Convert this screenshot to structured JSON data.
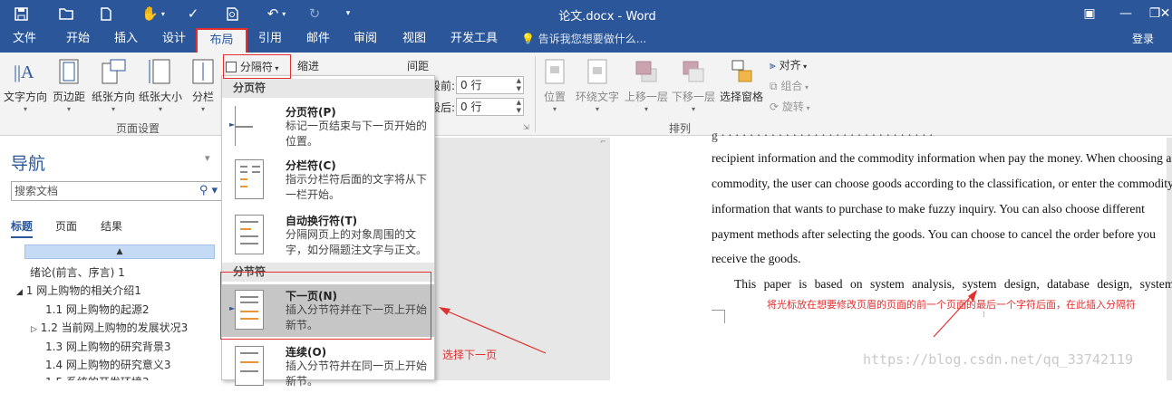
{
  "titlebar": {
    "title": "论文.docx - Word",
    "qat": {
      "save": "save-icon",
      "open": "open-folder-icon",
      "new": "new-document-icon",
      "touch": "touch-mode-icon",
      "spelling": "spelling-icon",
      "print_preview": "print-preview-icon",
      "undo": "undo-icon",
      "redo": "redo-icon",
      "customize": "customize-qat-icon"
    },
    "window_controls": [
      "ribbon-display-icon",
      "minimize-icon",
      "restore-icon",
      "close-icon"
    ]
  },
  "tabs": {
    "file": "文件",
    "home": "开始",
    "insert": "插入",
    "design": "设计",
    "layout": "布局",
    "references": "引用",
    "mailings": "邮件",
    "review": "审阅",
    "view": "视图",
    "developer": "开发工具"
  },
  "tell_me": "告诉我您想要做什么...",
  "signin": "登录",
  "ribbon": {
    "page_setup": {
      "text_direction": "文字方向",
      "margins": "页边距",
      "orientation": "纸张方向",
      "size": "纸张大小",
      "columns": "分栏",
      "breaks": "分隔符",
      "indent": "缩进",
      "spacing": "间距",
      "group_label": "页面设置",
      "spacing_before_label": "段前:",
      "spacing_before": "0 行",
      "spacing_after_label": "段后:",
      "spacing_after": "0 行"
    },
    "arrange": {
      "position": "位置",
      "wrap_text": "环绕文字",
      "bring_forward": "上移一层",
      "send_backward": "下移一层",
      "selection_pane": "选择窗格",
      "align": "对齐",
      "group": "组合",
      "rotate": "旋转",
      "group_label": "排列"
    }
  },
  "breaks_menu": {
    "page_breaks_header": "分页符",
    "section_breaks_header": "分节符",
    "items": [
      {
        "name": "分页符(P)",
        "desc": "标记一页结束与下一页开始的位置。"
      },
      {
        "name": "分栏符(C)",
        "desc": "指示分栏符后面的文字将从下一栏开始。"
      },
      {
        "name": "自动换行符(T)",
        "desc": "分隔网页上的对象周围的文字，如分隔题注文字与正文。"
      },
      {
        "name": "下一页(N)",
        "desc": "插入分节符并在下一页上开始新节。"
      },
      {
        "name": "连续(O)",
        "desc": "插入分节符并在同一页上开始新节。"
      }
    ]
  },
  "navigation": {
    "title": "导航",
    "search_placeholder": "搜索文档",
    "tabs": [
      "标题",
      "页面",
      "结果"
    ],
    "headings": [
      "绪论(前言、序言) 1",
      "1 网上购物的相关介绍1",
      "1.1 网上购物的起源2",
      "1.2 当前网上购物的发展状况3",
      "1.3 网上购物的研究背景3",
      "1.4 网上购物的研究意义3",
      "1.5 系统的开发环境3"
    ]
  },
  "document": {
    "lines": [
      "recipient information and the commodity information when pay the money. When choosing a",
      "commodity, the user can choose goods according to the classification, or enter the commodity",
      "information that wants to purchase to make fuzzy inquiry. You can also choose different",
      "payment methods after selecting the goods. You can choose to cancel the order before you",
      "receive the goods.",
      "This paper is based on system analysis, system design, database design, system"
    ]
  },
  "annotations": {
    "select_next_page": "选择下一页",
    "cursor_note": "将光标放在想要修改页眉的页面的前一个页面的最后一个字符后面，在此插入分隔符"
  },
  "watermark": "https://blog.csdn.net/qq_33742119",
  "colors": {
    "accent": "#2b579a",
    "highlight": "#e23030",
    "selected": "#c6c6c6"
  }
}
